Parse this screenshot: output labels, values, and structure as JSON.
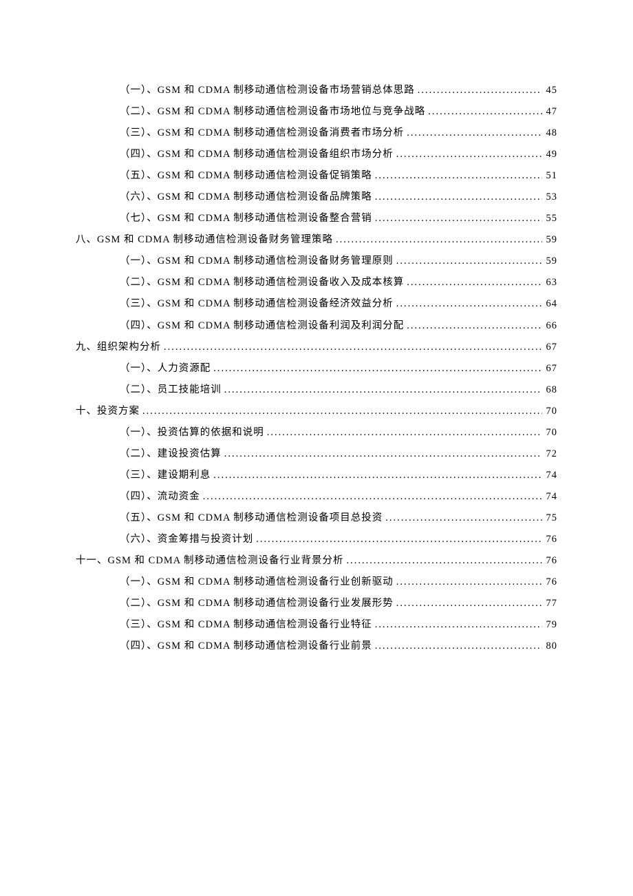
{
  "toc": [
    {
      "level": 2,
      "label": "（一）、GSM 和 CDMA 制移动通信检测设备市场营销总体思路",
      "page": "45"
    },
    {
      "level": 2,
      "label": "（二）、GSM 和 CDMA 制移动通信检测设备市场地位与竞争战略 ",
      "page": "47"
    },
    {
      "level": 2,
      "label": "（三）、GSM 和 CDMA 制移动通信检测设备消费者市场分析",
      "page": "48"
    },
    {
      "level": 2,
      "label": "（四）、GSM 和 CDMA 制移动通信检测设备组织市场分析",
      "page": "49"
    },
    {
      "level": 2,
      "label": "（五）、GSM 和 CDMA 制移动通信检测设备促销策略",
      "page": "51"
    },
    {
      "level": 2,
      "label": "（六）、GSM 和 CDMA 制移动通信检测设备品牌策略",
      "page": "53"
    },
    {
      "level": 2,
      "label": "（七）、GSM 和 CDMA 制移动通信检测设备整合营销",
      "page": "55"
    },
    {
      "level": 1,
      "label": "八、GSM 和 CDMA 制移动通信检测设备财务管理策略 ",
      "page": "59"
    },
    {
      "level": 2,
      "label": "（一）、GSM 和 CDMA 制移动通信检测设备财务管理原则",
      "page": "59"
    },
    {
      "level": 2,
      "label": "（二）、GSM 和 CDMA 制移动通信检测设备收入及成本核算",
      "page": "63"
    },
    {
      "level": 2,
      "label": "（三）、GSM 和 CDMA 制移动通信检测设备经济效益分析",
      "page": "64"
    },
    {
      "level": 2,
      "label": "（四）、GSM 和 CDMA 制移动通信检测设备利润及利润分配",
      "page": "66"
    },
    {
      "level": 1,
      "label": "九、组织架构分析 ",
      "page": "67"
    },
    {
      "level": 2,
      "label": "（一）、人力资源配",
      "page": "67"
    },
    {
      "level": 2,
      "label": "（二）、员工技能培训",
      "page": "68"
    },
    {
      "level": 1,
      "label": "十、投资方案 ",
      "page": "70"
    },
    {
      "level": 2,
      "label": "（一）、投资估算的依据和说明",
      "page": "70"
    },
    {
      "level": 2,
      "label": "（二）、建设投资估算",
      "page": "72"
    },
    {
      "level": 2,
      "label": "（三）、建设期利息",
      "page": "74"
    },
    {
      "level": 2,
      "label": "（四）、流动资金",
      "page": "74"
    },
    {
      "level": 2,
      "label": "（五）、GSM 和 CDMA 制移动通信检测设备项目总投资 ",
      "page": "75"
    },
    {
      "level": 2,
      "label": "（六）、资金筹措与投资计划",
      "page": "76"
    },
    {
      "level": 1,
      "label": "十一、GSM 和 CDMA 制移动通信检测设备行业背景分析 ",
      "page": "76"
    },
    {
      "level": 2,
      "label": "（一）、GSM 和 CDMA 制移动通信检测设备行业创新驱动",
      "page": "76"
    },
    {
      "level": 2,
      "label": "（二）、GSM 和 CDMA 制移动通信检测设备行业发展形势",
      "page": "77"
    },
    {
      "level": 2,
      "label": "（三）、GSM 和 CDMA 制移动通信检测设备行业特征",
      "page": "79"
    },
    {
      "level": 2,
      "label": "（四）、GSM 和 CDMA 制移动通信检测设备行业前景",
      "page": "80"
    }
  ]
}
